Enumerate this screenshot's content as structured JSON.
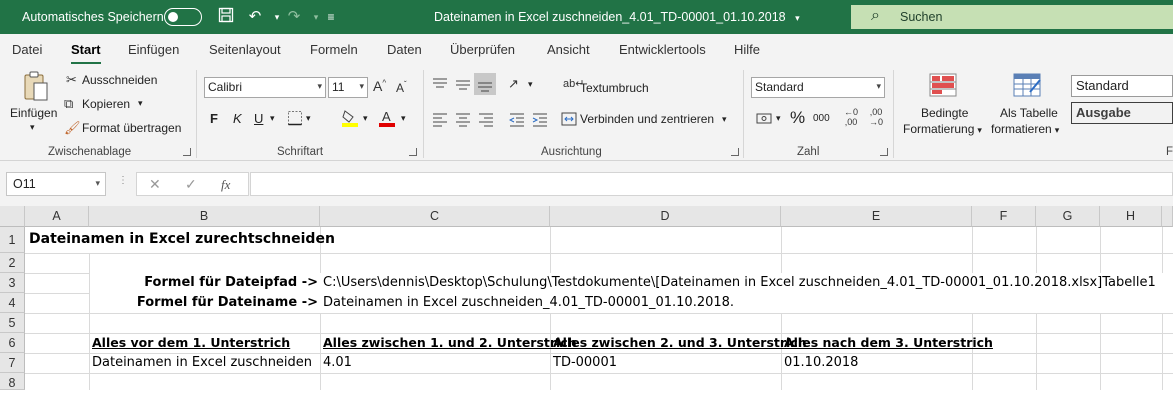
{
  "titlebar": {
    "autosave_label": "Automatisches Speichern",
    "doc_title": "Dateinamen in Excel zuschneiden_4.01_TD-00001_01.10.2018",
    "doc_title_chevron": "▾",
    "search_label": "Suchen"
  },
  "menu": {
    "tabs": [
      "Datei",
      "Start",
      "Einfügen",
      "Seitenlayout",
      "Formeln",
      "Daten",
      "Überprüfen",
      "Ansicht",
      "Entwicklertools",
      "Hilfe"
    ],
    "active": "Start"
  },
  "ribbon": {
    "clipboard": {
      "paste": "Einfügen",
      "cut": "Ausschneiden",
      "copy": "Kopieren",
      "format_painter": "Format übertragen",
      "label": "Zwischenablage"
    },
    "font": {
      "name": "Calibri",
      "size": "11",
      "bold": "F",
      "italic": "K",
      "underline": "U",
      "label": "Schriftart"
    },
    "alignment": {
      "wrap": "Textumbruch",
      "merge": "Verbinden und zentrieren",
      "label": "Ausrichtung"
    },
    "number": {
      "format": "Standard",
      "percent": "%",
      "thousands": "000",
      "label": "Zahl"
    },
    "styles": {
      "conditional_1": "Bedingte",
      "conditional_2": "Formatierung",
      "table_1": "Als Tabelle",
      "table_2": "formatieren",
      "style_standard": "Standard",
      "style_ausgabe": "Ausgabe",
      "label_partial": "F"
    }
  },
  "formula_bar": {
    "name_box": "O11",
    "fx": "fx",
    "formula": ""
  },
  "sheet": {
    "columns": [
      "A",
      "B",
      "C",
      "D",
      "E",
      "F",
      "G",
      "H"
    ],
    "rows": [
      "1",
      "2",
      "3",
      "4",
      "5",
      "6",
      "7",
      "8"
    ],
    "cells": {
      "A1": "Dateinamen in Excel zurechtschneiden",
      "B3": "Formel für Dateipfad ->",
      "C3": "C:\\Users\\dennis\\Desktop\\Schulung\\Testdokumente\\[Dateinamen in Excel zuschneiden_4.01_TD-00001_01.10.2018.xlsx]Tabelle1",
      "B4": "Formel für Dateiname ->",
      "C4": "Dateinamen in Excel zuschneiden_4.01_TD-00001_01.10.2018.",
      "B6": "Alles vor dem 1. Unterstrich",
      "C6": "Alles zwischen 1. und 2. Unterstrich",
      "D6": "Alles zwischen 2. und 3. Unterstrich",
      "E6": "Alles nach dem 3. Unterstrich",
      "B7": "Dateinamen in Excel zuschneiden",
      "C7": "4.01",
      "D7": "TD-00001",
      "E7": "01.10.2018"
    }
  },
  "colors": {
    "excel_green": "#217346",
    "search_bg": "#c6e0b4",
    "ribbon_bg": "#f3f3f3",
    "header_bg": "#e6e6e6"
  }
}
